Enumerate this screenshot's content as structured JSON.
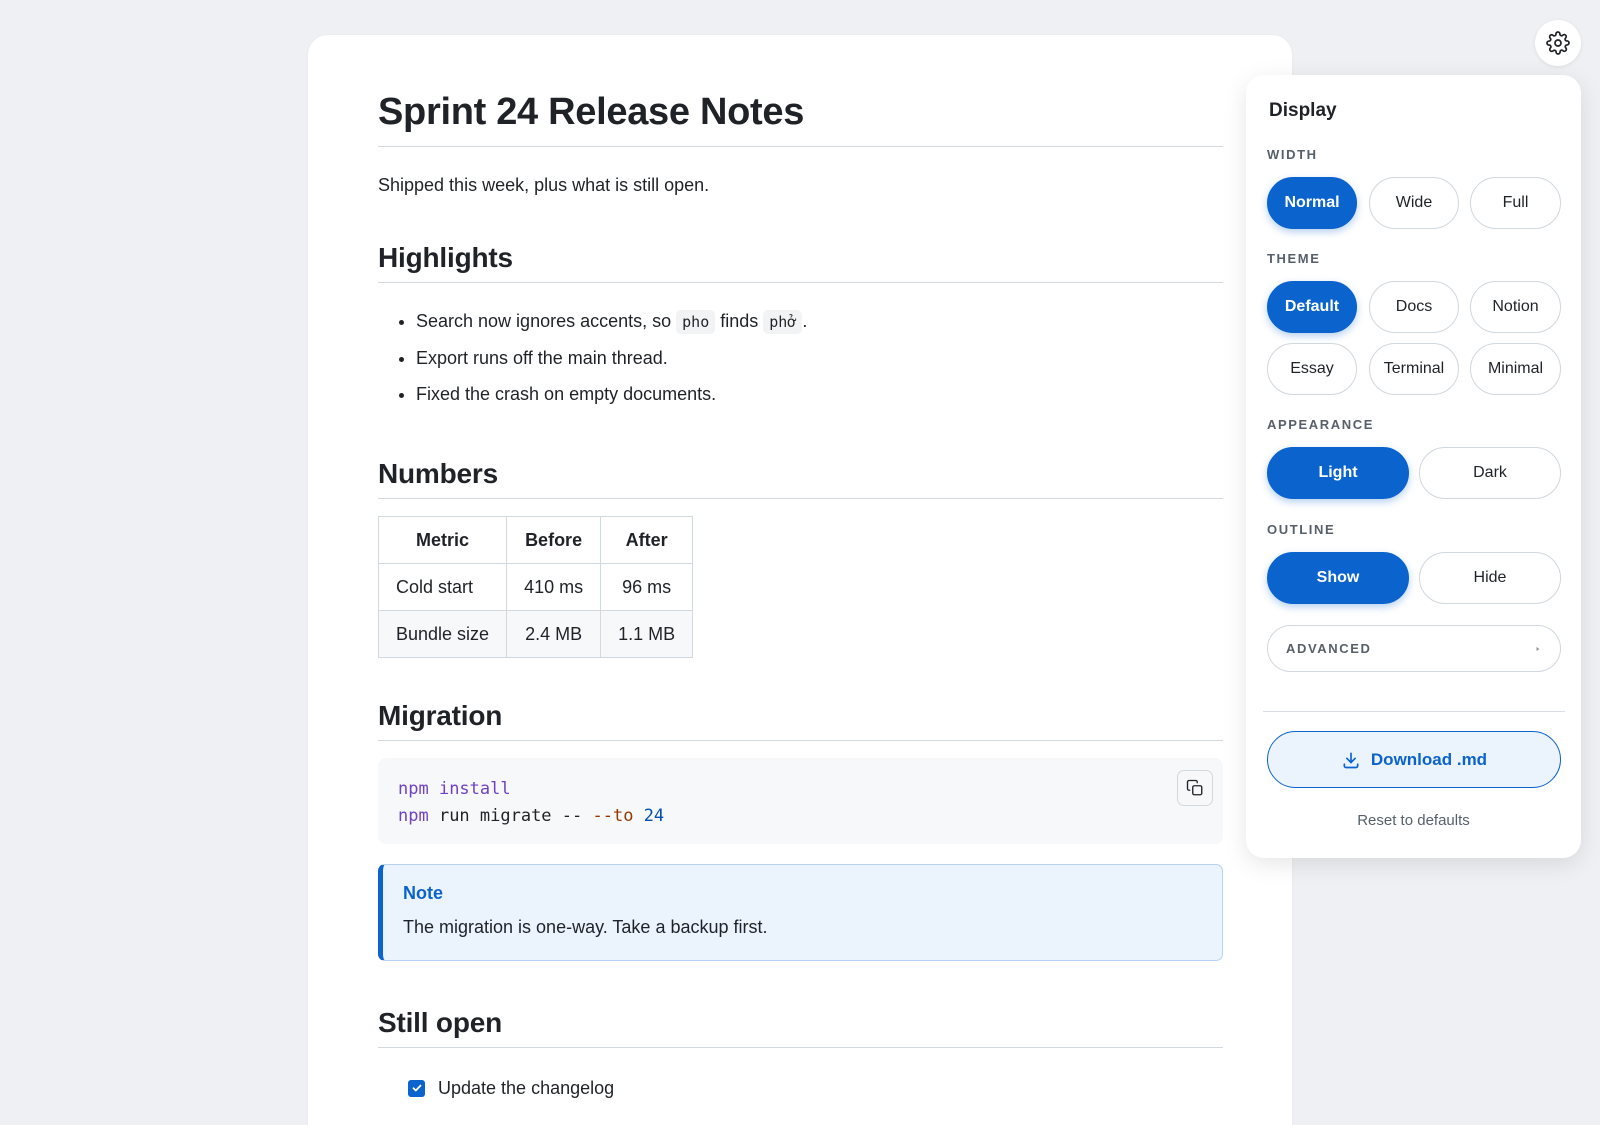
{
  "doc": {
    "title": "Sprint 24 Release Notes",
    "intro": "Shipped this week, plus what is still open.",
    "highlights": {
      "heading": "Highlights",
      "items": [
        {
          "before": "Search now ignores accents, so ",
          "code1": "pho",
          "mid": " finds ",
          "code2": "phở",
          "after": "."
        },
        {
          "text": "Export runs off the main thread."
        },
        {
          "text": "Fixed the crash on empty documents."
        }
      ]
    },
    "numbers": {
      "heading": "Numbers",
      "headers": [
        "Metric",
        "Before",
        "After"
      ],
      "rows": [
        [
          "Cold start",
          "410 ms",
          "96 ms"
        ],
        [
          "Bundle size",
          "2.4 MB",
          "1.1 MB"
        ]
      ]
    },
    "migration": {
      "heading": "Migration",
      "code": {
        "line1": {
          "cmd": "npm",
          "rest": " install"
        },
        "line2": {
          "cmd": "npm",
          "rest": " run migrate -- ",
          "flag": "--to",
          "sp": " ",
          "num": "24"
        }
      },
      "note_title": "Note",
      "note_body": "The migration is one-way. Take a backup first."
    },
    "still_open": {
      "heading": "Still open",
      "tasks": [
        {
          "label": "Update the changelog",
          "done": true
        }
      ]
    }
  },
  "panel": {
    "title": "Display",
    "width_label": "WIDTH",
    "width_options": [
      "Normal",
      "Wide",
      "Full"
    ],
    "width_selected": "Normal",
    "theme_label": "THEME",
    "theme_options": [
      "Default",
      "Docs",
      "Notion",
      "Essay",
      "Terminal",
      "Minimal"
    ],
    "theme_selected": "Default",
    "appearance_label": "APPEARANCE",
    "appearance_options": [
      "Light",
      "Dark"
    ],
    "appearance_selected": "Light",
    "outline_label": "OUTLINE",
    "outline_options": [
      "Show",
      "Hide"
    ],
    "outline_selected": "Show",
    "advanced_label": "ADVANCED",
    "download_label": "Download .md",
    "reset_label": "Reset to defaults"
  },
  "colors": {
    "accent": "#0b63ce",
    "background": "#eef0f3"
  },
  "icons": {
    "settings": "gear-icon",
    "copy": "copy-icon",
    "download": "download-icon",
    "advanced": "caret-right-icon"
  }
}
